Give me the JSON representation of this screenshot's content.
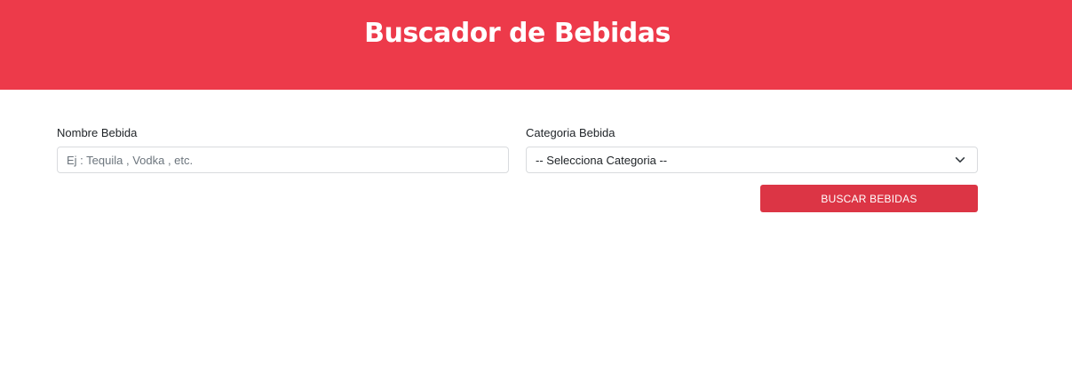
{
  "header": {
    "title": "Buscador de Bebidas"
  },
  "form": {
    "nombre": {
      "label": "Nombre Bebida",
      "placeholder": "Ej : Tequila , Vodka , etc.",
      "value": ""
    },
    "categoria": {
      "label": "Categoria Bebida",
      "selected": "-- Selecciona Categoria --"
    },
    "submit_label": "BUSCAR BEBIDAS"
  },
  "colors": {
    "header_bg": "#ed3a4a",
    "button_bg": "#dc3545",
    "text": "#212529"
  },
  "icons": {
    "select_arrow": "chevron-down-icon"
  }
}
